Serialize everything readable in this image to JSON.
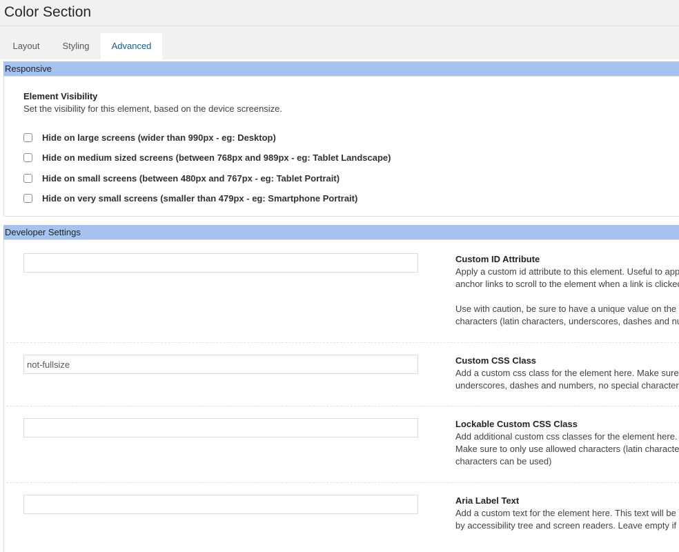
{
  "page": {
    "title": "Color Section"
  },
  "tabs": [
    {
      "label": "Layout",
      "active": false
    },
    {
      "label": "Styling",
      "active": false
    },
    {
      "label": "Advanced",
      "active": true
    }
  ],
  "responsive": {
    "header": "Responsive",
    "visibility_title": "Element Visibility",
    "visibility_desc": "Set the visibility for this element, based on the device screensize.",
    "options": [
      {
        "label": "Hide on large screens (wider than 990px - eg: Desktop)",
        "checked": false
      },
      {
        "label": "Hide on medium sized screens (between 768px and 989px - eg: Tablet Landscape)",
        "checked": false
      },
      {
        "label": "Hide on small screens (between 480px and 767px - eg: Tablet Portrait)",
        "checked": false
      },
      {
        "label": "Hide on very small screens (smaller than 479px - eg: Smartphone Portrait)",
        "checked": false
      }
    ]
  },
  "developer": {
    "header": "Developer Settings",
    "fields": [
      {
        "value": "",
        "label": "Custom ID Attribute",
        "lines": [
          "Apply a custom id attribute to this element. Useful to appl",
          "anchor links to scroll to the element when a link is clicked"
        ],
        "lines2": [
          "Use with caution, be sure to have a unique value on the pa",
          "characters (latin characters, underscores, dashes and nur"
        ]
      },
      {
        "value": "not-fullsize",
        "label": "Custom CSS Class",
        "lines": [
          "Add a custom css class for the element here. Make sure to",
          "underscores, dashes and numbers, no special characters"
        ]
      },
      {
        "value": "",
        "label": "Lockable Custom CSS Class",
        "lines": [
          "Add additional custom css classes for the element here. T",
          "Make sure to only use allowed characters (latin characters",
          "characters can be used)"
        ]
      },
      {
        "value": "",
        "label": "Aria Label Text",
        "lines": [
          "Add a custom text for the element here. This text will be a",
          "by accessibility tree and screen readers. Leave empty if no"
        ]
      }
    ]
  },
  "colors": {
    "section_header_bg": "#a6c2ee",
    "active_tab_text": "#135e96"
  }
}
